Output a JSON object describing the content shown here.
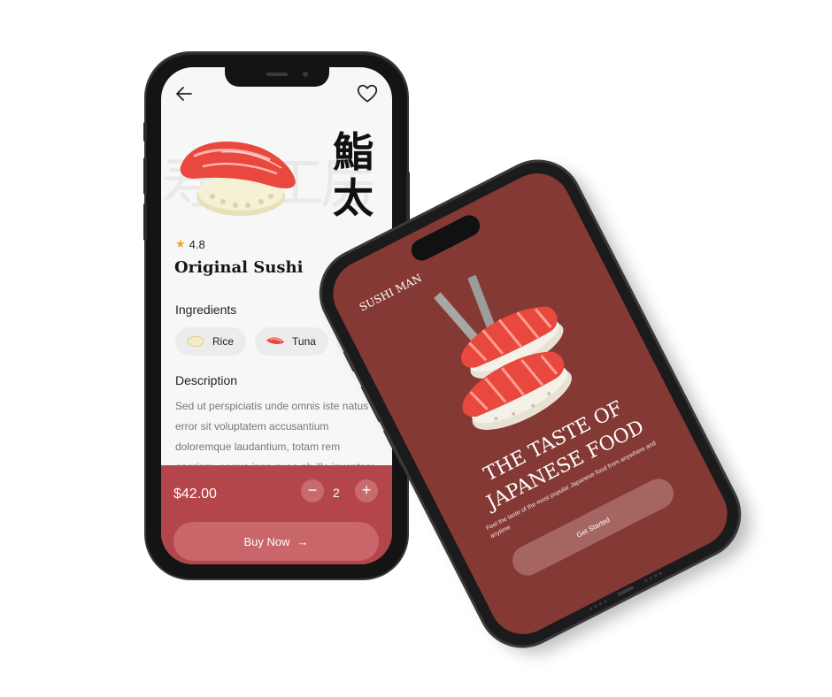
{
  "detail_screen": {
    "rating": "4.8",
    "title": "Original Sushi",
    "kanji_top": "鮨",
    "kanji_bottom": "太",
    "ingredients_label": "Ingredients",
    "ingredients": [
      {
        "name": "Rice",
        "icon": "rice-icon"
      },
      {
        "name": "Tuna",
        "icon": "tuna-icon"
      }
    ],
    "description_label": "Description",
    "description": "Sed ut perspiciatis unde omnis iste natus error sit voluptatem accusantium doloremque laudantium, totam rem aperiam, eaque ipsa quae ab illo inventore",
    "price": "$42.00",
    "quantity": "2",
    "minus_label": "−",
    "plus_label": "+",
    "buy_label": "Buy Now",
    "buy_arrow": "→"
  },
  "landing_screen": {
    "brand": "SUSHI MAN",
    "headline_line1": "THE TASTE OF",
    "headline_line2": "JAPANESE FOOD",
    "subtext": "Feel the taste of the most popular Japanese food from anywhere and anytime",
    "cta_label": "Get Started"
  },
  "colors": {
    "detail_bottom_bar": "#b4454a",
    "landing_background": "#843934",
    "star": "#f5a623"
  }
}
